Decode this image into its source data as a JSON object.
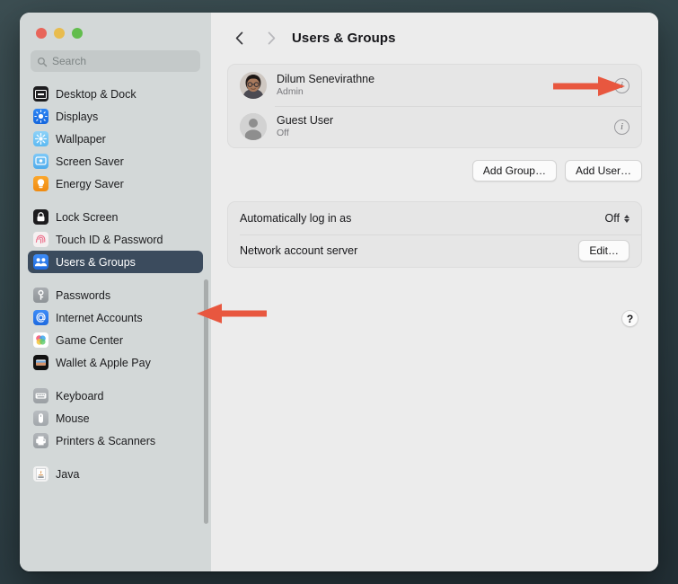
{
  "window": {
    "traffic_lights": [
      "close",
      "minimize",
      "zoom"
    ],
    "search": {
      "placeholder": "Search",
      "value": "",
      "icon": "search-icon"
    }
  },
  "sidebar": {
    "groups": [
      {
        "items": [
          {
            "label": "Desktop & Dock",
            "icon": "desktop-and-dock-icon",
            "selected": false
          },
          {
            "label": "Displays",
            "icon": "displays-icon",
            "selected": false
          },
          {
            "label": "Wallpaper",
            "icon": "wallpaper-icon",
            "selected": false
          },
          {
            "label": "Screen Saver",
            "icon": "screen-saver-icon",
            "selected": false
          },
          {
            "label": "Energy Saver",
            "icon": "energy-saver-icon",
            "selected": false
          }
        ]
      },
      {
        "items": [
          {
            "label": "Lock Screen",
            "icon": "lock-screen-icon",
            "selected": false
          },
          {
            "label": "Touch ID & Password",
            "icon": "touch-id-icon",
            "selected": false
          },
          {
            "label": "Users & Groups",
            "icon": "users-and-groups-icon",
            "selected": true
          }
        ]
      },
      {
        "items": [
          {
            "label": "Passwords",
            "icon": "passwords-key-icon",
            "selected": false
          },
          {
            "label": "Internet Accounts",
            "icon": "internet-accounts-icon",
            "selected": false
          },
          {
            "label": "Game Center",
            "icon": "game-center-icon",
            "selected": false
          },
          {
            "label": "Wallet & Apple Pay",
            "icon": "wallet-icon",
            "selected": false
          }
        ]
      },
      {
        "items": [
          {
            "label": "Keyboard",
            "icon": "keyboard-icon",
            "selected": false
          },
          {
            "label": "Mouse",
            "icon": "mouse-icon",
            "selected": false
          },
          {
            "label": "Printers & Scanners",
            "icon": "printers-icon",
            "selected": false
          }
        ]
      },
      {
        "items": [
          {
            "label": "Java",
            "icon": "java-icon",
            "selected": false
          }
        ]
      }
    ]
  },
  "toolbar": {
    "back_icon": "chevron-left-icon",
    "forward_icon": "chevron-right-icon",
    "title": "Users & Groups"
  },
  "users": [
    {
      "name": "Dilum Senevirathne",
      "role": "Admin",
      "avatar": "user-photo-avatar",
      "info_icon": "info-icon"
    },
    {
      "name": "Guest User",
      "role": "Off",
      "avatar": "generic-person-avatar",
      "info_icon": "info-icon"
    }
  ],
  "actions": {
    "add_group": "Add Group…",
    "add_user": "Add User…"
  },
  "settings": [
    {
      "label": "Automatically log in as",
      "value": "Off",
      "control": "popup-menu"
    },
    {
      "label": "Network account server",
      "value": "Edit…",
      "control": "button"
    }
  ],
  "help": {
    "label": "?"
  },
  "annotations": {
    "color": "#e8573f",
    "arrows": [
      {
        "name": "arrow-to-info-button",
        "direction": "right"
      },
      {
        "name": "arrow-to-users-and-groups",
        "direction": "left"
      }
    ]
  }
}
